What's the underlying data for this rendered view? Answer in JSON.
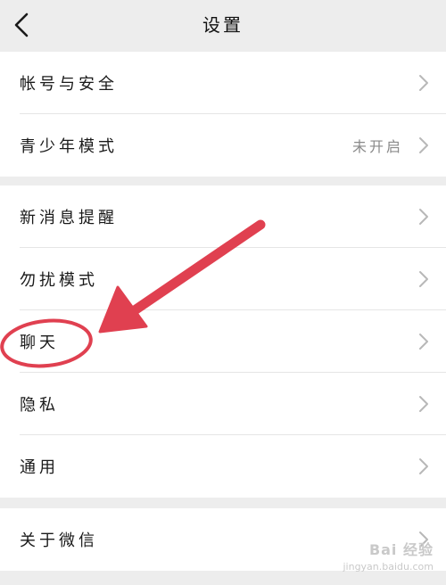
{
  "header": {
    "title": "设置",
    "back_icon": "chevron-left-icon"
  },
  "groups": [
    {
      "items": [
        {
          "label": "帐号与安全",
          "value": ""
        },
        {
          "label": "青少年模式",
          "value": "未开启"
        }
      ]
    },
    {
      "items": [
        {
          "label": "新消息提醒",
          "value": ""
        },
        {
          "label": "勿扰模式",
          "value": ""
        },
        {
          "label": "聊天",
          "value": ""
        },
        {
          "label": "隐私",
          "value": ""
        },
        {
          "label": "通用",
          "value": ""
        }
      ]
    },
    {
      "items": [
        {
          "label": "关于微信",
          "value": ""
        }
      ]
    }
  ],
  "annotation": {
    "color": "#e04050",
    "marks": [
      "red-arrow",
      "red-circle"
    ]
  },
  "watermark": {
    "brand": "Bai 经验",
    "url": "jingyan.baidu.com"
  }
}
